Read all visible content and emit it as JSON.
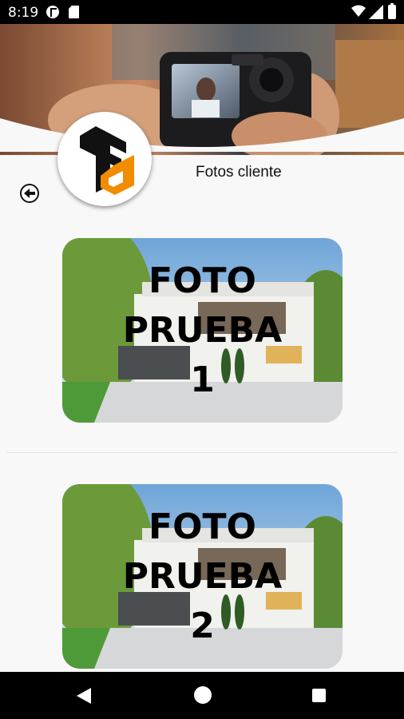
{
  "status_bar": {
    "time": "8:19",
    "icons": [
      "app-notification-icon",
      "sd-card-icon",
      "wifi-icon",
      "signal-icon",
      "battery-icon"
    ]
  },
  "header": {
    "page_title": "Fotos cliente",
    "logo": {
      "icon": "fd-logo",
      "colors": {
        "dark": "#111111",
        "accent": "#f28c00"
      }
    }
  },
  "back_button": {
    "icon": "arrow-left-circle-icon"
  },
  "photos": [
    {
      "line1": "FOTO",
      "line2": "PRUEBA",
      "line3": "1"
    },
    {
      "line1": "FOTO",
      "line2": "PRUEBA",
      "line3": "2"
    }
  ],
  "nav_bar": {
    "icons": [
      "back-triangle-icon",
      "home-circle-icon",
      "recents-square-icon"
    ]
  },
  "colors": {
    "background": "#f8f8f8",
    "status_bar": "#000000",
    "accent": "#f28c00"
  }
}
